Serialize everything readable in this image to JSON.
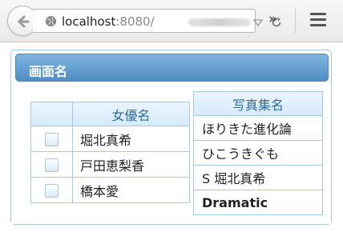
{
  "browser": {
    "url_host": "localhost",
    "url_port": ":8080/",
    "icons": [
      "back-icon",
      "globe-icon",
      "dropmarker-icon",
      "reload-icon",
      "overflow-icon",
      "hamburger-menu-icon"
    ]
  },
  "page": {
    "title": "画面名",
    "actress_table": {
      "header": "女優名",
      "rows": [
        {
          "checked": false,
          "name": "堀北真希"
        },
        {
          "checked": false,
          "name": "戸田恵梨香"
        },
        {
          "checked": false,
          "name": "橋本愛"
        }
      ]
    },
    "photobook_table": {
      "header": "写真集名",
      "rows": [
        {
          "title": "ほりきた進化論",
          "bold": false
        },
        {
          "title": "ひこうきぐも",
          "bold": false
        },
        {
          "title": "S 堀北真希",
          "bold": false
        },
        {
          "title": "Dramatic",
          "bold": true
        }
      ]
    }
  },
  "colors": {
    "header_gradient_top": "#7fb5e0",
    "header_gradient_bottom": "#4f8dc5",
    "table_border": "#a6c9e2",
    "table_header_text": "#2e6e9e"
  }
}
